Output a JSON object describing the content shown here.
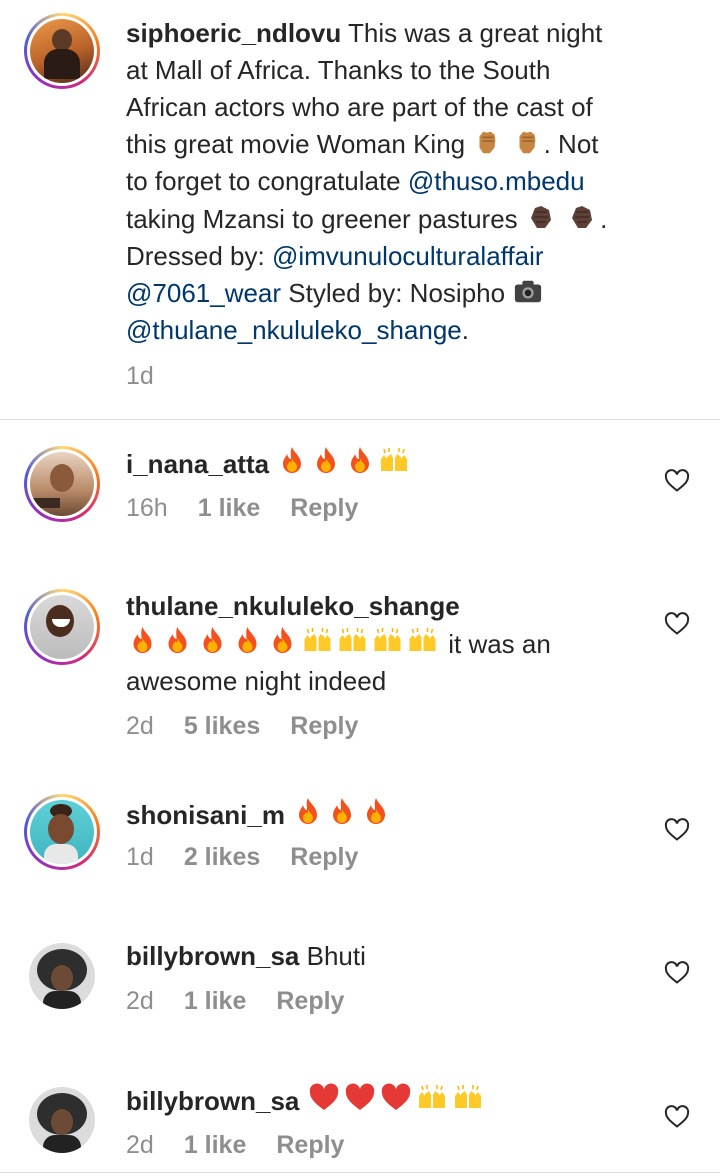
{
  "caption": {
    "username": "siphoeric_ndlovu",
    "lines": [
      "This was a great night",
      "at Mall of Africa. Thanks to the South",
      "African actors who are part of the cast of",
      "this great movie Woman King"
    ],
    "line4_end": ". Not",
    "line5_pre": "to forget to congratulate ",
    "mention1": "@thuso.mbedu",
    "line6": "taking Mzansi to greener pastures",
    "line6_end": ".",
    "line7_pre": "Dressed by: ",
    "mention2": "@imvunuloculturalaffair",
    "mention3": "@7061_wear",
    "line8_mid": " Styled by: Nosipho ",
    "mention4": "@thulane_nkululeko_shange",
    "line9_end": ".",
    "time": "1d",
    "emoji": [
      "raised-fist-emoji",
      "clapping-hands-emoji",
      "camera-emoji"
    ]
  },
  "comments": [
    {
      "username": "i_nana_atta",
      "text": "",
      "time": "16h",
      "likes": "1 like",
      "reply": "Reply",
      "emoji": [
        "fire-emoji",
        "raising-hands-emoji"
      ]
    },
    {
      "username": "thulane_nkululeko_shange",
      "text": " it was an",
      "text2": "awesome night indeed",
      "time": "2d",
      "likes": "5 likes",
      "reply": "Reply",
      "emoji": [
        "fire-emoji",
        "raising-hands-emoji"
      ]
    },
    {
      "username": "shonisani_m",
      "text": "",
      "time": "1d",
      "likes": "2 likes",
      "reply": "Reply",
      "emoji": [
        "fire-emoji"
      ]
    },
    {
      "username": "billybrown_sa",
      "text": " Bhuti",
      "time": "2d",
      "likes": "1 like",
      "reply": "Reply",
      "emoji": []
    },
    {
      "username": "billybrown_sa",
      "text": "",
      "time": "2d",
      "likes": "1 like",
      "reply": "Reply",
      "emoji": [
        "red-heart-emoji",
        "raising-hands-emoji"
      ]
    }
  ],
  "icons": {
    "like": "heart-outline-icon"
  },
  "colors": {
    "text": "#262626",
    "meta": "#8e8e8e",
    "mention": "#00376b",
    "divider": "#dbdbdb"
  }
}
